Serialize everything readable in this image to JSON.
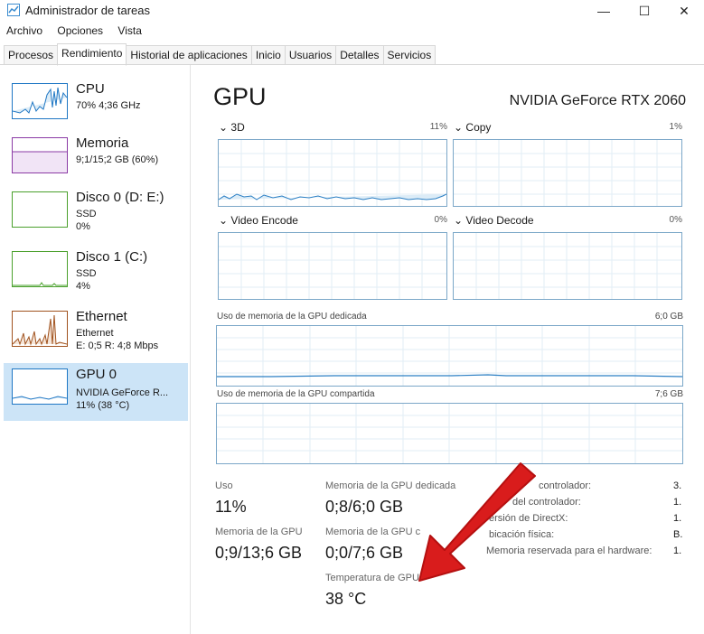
{
  "window": {
    "title": "Administrador de tareas",
    "min": "—",
    "max": "☐",
    "close": "✕"
  },
  "menu": [
    "Archivo",
    "Opciones",
    "Vista"
  ],
  "tabs": [
    "Procesos",
    "Rendimiento",
    "Historial de aplicaciones",
    "Inicio",
    "Usuarios",
    "Detalles",
    "Servicios"
  ],
  "sidebar": [
    {
      "name": "CPU",
      "line1": "70%  4;36 GHz",
      "line2": "",
      "color": "#1f77c4"
    },
    {
      "name": "Memoria",
      "line1": "9;1/15;2 GB (60%)",
      "line2": "",
      "color": "#8b3aa5"
    },
    {
      "name": "Disco 0 (D: E:)",
      "line1": "SSD",
      "line2": "0%",
      "color": "#4aa02c"
    },
    {
      "name": "Disco 1 (C:)",
      "line1": "SSD",
      "line2": "4%",
      "color": "#4aa02c"
    },
    {
      "name": "Ethernet",
      "line1": "Ethernet",
      "line2": "E: 0;5  R: 4;8 Mbps",
      "color": "#a0521e"
    },
    {
      "name": "GPU 0",
      "line1": "NVIDIA GeForce R...",
      "line2": "11% (38 °C)",
      "color": "#1f77c4"
    }
  ],
  "main": {
    "title": "GPU",
    "model": "NVIDIA GeForce RTX 2060",
    "engines": [
      {
        "label": "3D",
        "pct": "11%"
      },
      {
        "label": "Copy",
        "pct": "1%"
      },
      {
        "label": "Video Encode",
        "pct": "0%"
      },
      {
        "label": "Video Decode",
        "pct": "0%"
      }
    ],
    "dedicated": {
      "label": "Uso de memoria de la GPU dedicada",
      "max": "6;0 GB"
    },
    "shared": {
      "label": "Uso de memoria de la GPU compartida",
      "max": "7;6 GB"
    },
    "stats": {
      "uso_label": "Uso",
      "uso_value": "11%",
      "mem_ded_label": "Memoria de la GPU dedicada",
      "mem_ded_value": "0;8/6;0 GB",
      "mem_gpu_label": "Memoria de la GPU",
      "mem_gpu_value": "0;9/13;6 GB",
      "mem_shared_label": "Memoria de la GPU c",
      "mem_shared_value": "0;0/7;6 GB",
      "temp_label": "Temperatura de GPU",
      "temp_value": "38 °C"
    },
    "info": [
      {
        "label": "controlador:",
        "value": "3."
      },
      {
        "label": "del controlador:",
        "value": "1."
      },
      {
        "label": "ersión de DirectX:",
        "value": "1."
      },
      {
        "label": "bicación física:",
        "value": "B."
      },
      {
        "label": "Memoria reservada para el hardware:",
        "value": "1."
      }
    ],
    "arrow_color": "#d91c1c"
  }
}
